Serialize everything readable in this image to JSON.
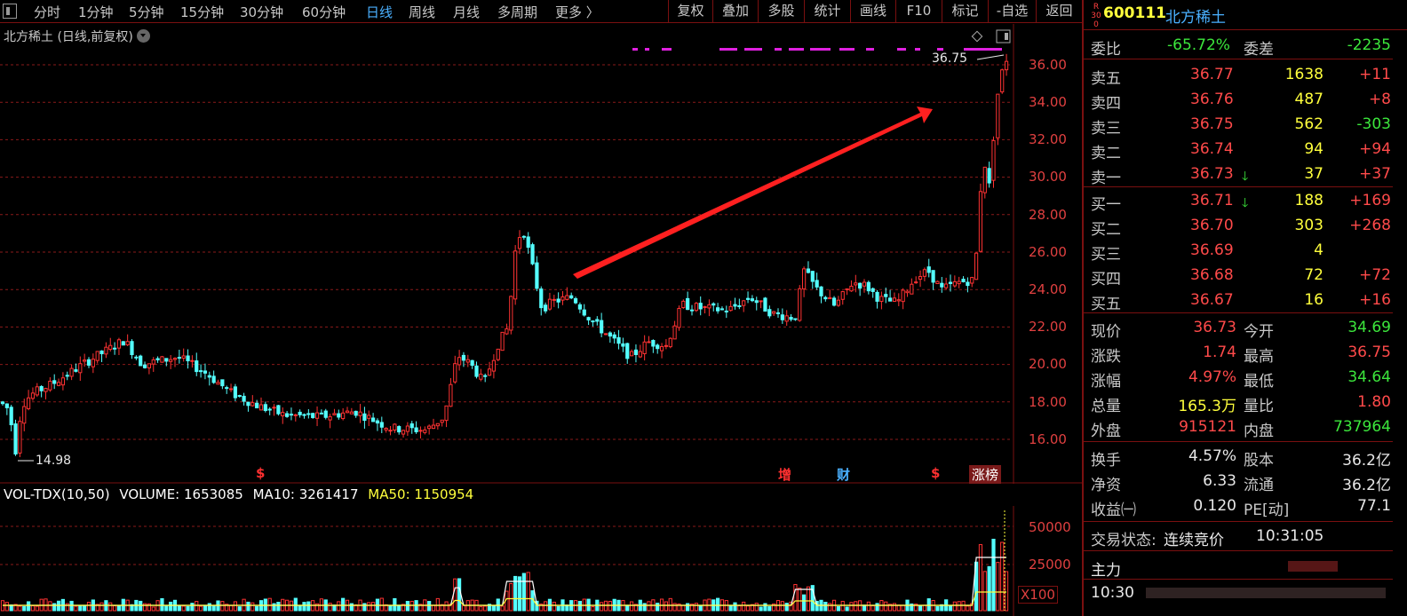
{
  "toolbar": {
    "periods": [
      "分时",
      "1分钟",
      "5分钟",
      "15分钟",
      "30分钟",
      "60分钟",
      "日线",
      "周线",
      "月线",
      "多周期",
      "更多 〉"
    ],
    "active_period": "日线",
    "tools": [
      "复权",
      "叠加",
      "多股",
      "统计",
      "画线",
      "F10",
      "标记",
      "-自选",
      "返回"
    ]
  },
  "chart": {
    "title": "北方稀土 (日线,前复权)",
    "price_axis": [
      "36.00",
      "34.00",
      "32.00",
      "30.00",
      "28.00",
      "26.00",
      "24.00",
      "22.00",
      "20.00",
      "18.00",
      "16.00"
    ],
    "high_label": "36.75",
    "low_label": "14.98",
    "signals": [
      {
        "text": "$",
        "color": "#ff3030"
      },
      {
        "text": "增",
        "color": "#ff3030"
      },
      {
        "text": "财",
        "color": "#4ab0ff"
      },
      {
        "text": "$",
        "color": "#ff3030"
      },
      {
        "text": "涨榜",
        "color": "#ffffff"
      }
    ]
  },
  "volume": {
    "indicator": "VOL-TDX(10,50)",
    "volume_label": "VOLUME: 1653085",
    "ma10_label": "MA10: 3261417",
    "ma50_label": "MA50: 1150954",
    "axis": [
      "50000",
      "25000"
    ],
    "unit": "X100"
  },
  "quote": {
    "badge": "R 300",
    "code": "600111",
    "name": "北方稀土",
    "weibi_label": "委比",
    "weibi": "-65.72%",
    "weicha_label": "委差",
    "weicha": "-2235",
    "asks": [
      {
        "label": "卖五",
        "price": "36.77",
        "vol": "1638",
        "chg": "+11"
      },
      {
        "label": "卖四",
        "price": "36.76",
        "vol": "487",
        "chg": "+8"
      },
      {
        "label": "卖三",
        "price": "36.75",
        "vol": "562",
        "chg": "-303"
      },
      {
        "label": "卖二",
        "price": "36.74",
        "vol": "94",
        "chg": "+94"
      },
      {
        "label": "卖一",
        "price": "36.73",
        "vol": "37",
        "chg": "+37"
      }
    ],
    "bids": [
      {
        "label": "买一",
        "price": "36.71",
        "vol": "188",
        "chg": "+169"
      },
      {
        "label": "买二",
        "price": "36.70",
        "vol": "303",
        "chg": "+268"
      },
      {
        "label": "买三",
        "price": "36.69",
        "vol": "4",
        "chg": ""
      },
      {
        "label": "买四",
        "price": "36.68",
        "vol": "72",
        "chg": "+72"
      },
      {
        "label": "买五",
        "price": "36.67",
        "vol": "16",
        "chg": "+16"
      }
    ],
    "stats": [
      {
        "l1": "现价",
        "v1": "36.73",
        "c1": "red",
        "l2": "今开",
        "v2": "34.69",
        "c2": "green"
      },
      {
        "l1": "涨跌",
        "v1": "1.74",
        "c1": "red",
        "l2": "最高",
        "v2": "36.75",
        "c2": "red"
      },
      {
        "l1": "涨幅",
        "v1": "4.97%",
        "c1": "red",
        "l2": "最低",
        "v2": "34.64",
        "c2": "green"
      },
      {
        "l1": "总量",
        "v1": "165.3万",
        "c1": "yellow",
        "l2": "量比",
        "v2": "1.80",
        "c2": "red"
      },
      {
        "l1": "外盘",
        "v1": "915121",
        "c1": "red",
        "l2": "内盘",
        "v2": "737964",
        "c2": "green"
      }
    ],
    "fund": [
      {
        "l1": "换手",
        "v1": "4.57%",
        "l2": "股本",
        "v2": "36.2亿"
      },
      {
        "l1": "净资",
        "v1": "6.33",
        "l2": "流通",
        "v2": "36.2亿"
      },
      {
        "l1": "收益㈠",
        "v1": "0.120",
        "l2": "PE[动]",
        "v2": "77.1"
      }
    ],
    "trade_state_label": "交易状态:",
    "trade_state": "连续竞价",
    "trade_time": "10:31:05",
    "flow_label": "主力",
    "tick_time": "10:30"
  }
}
